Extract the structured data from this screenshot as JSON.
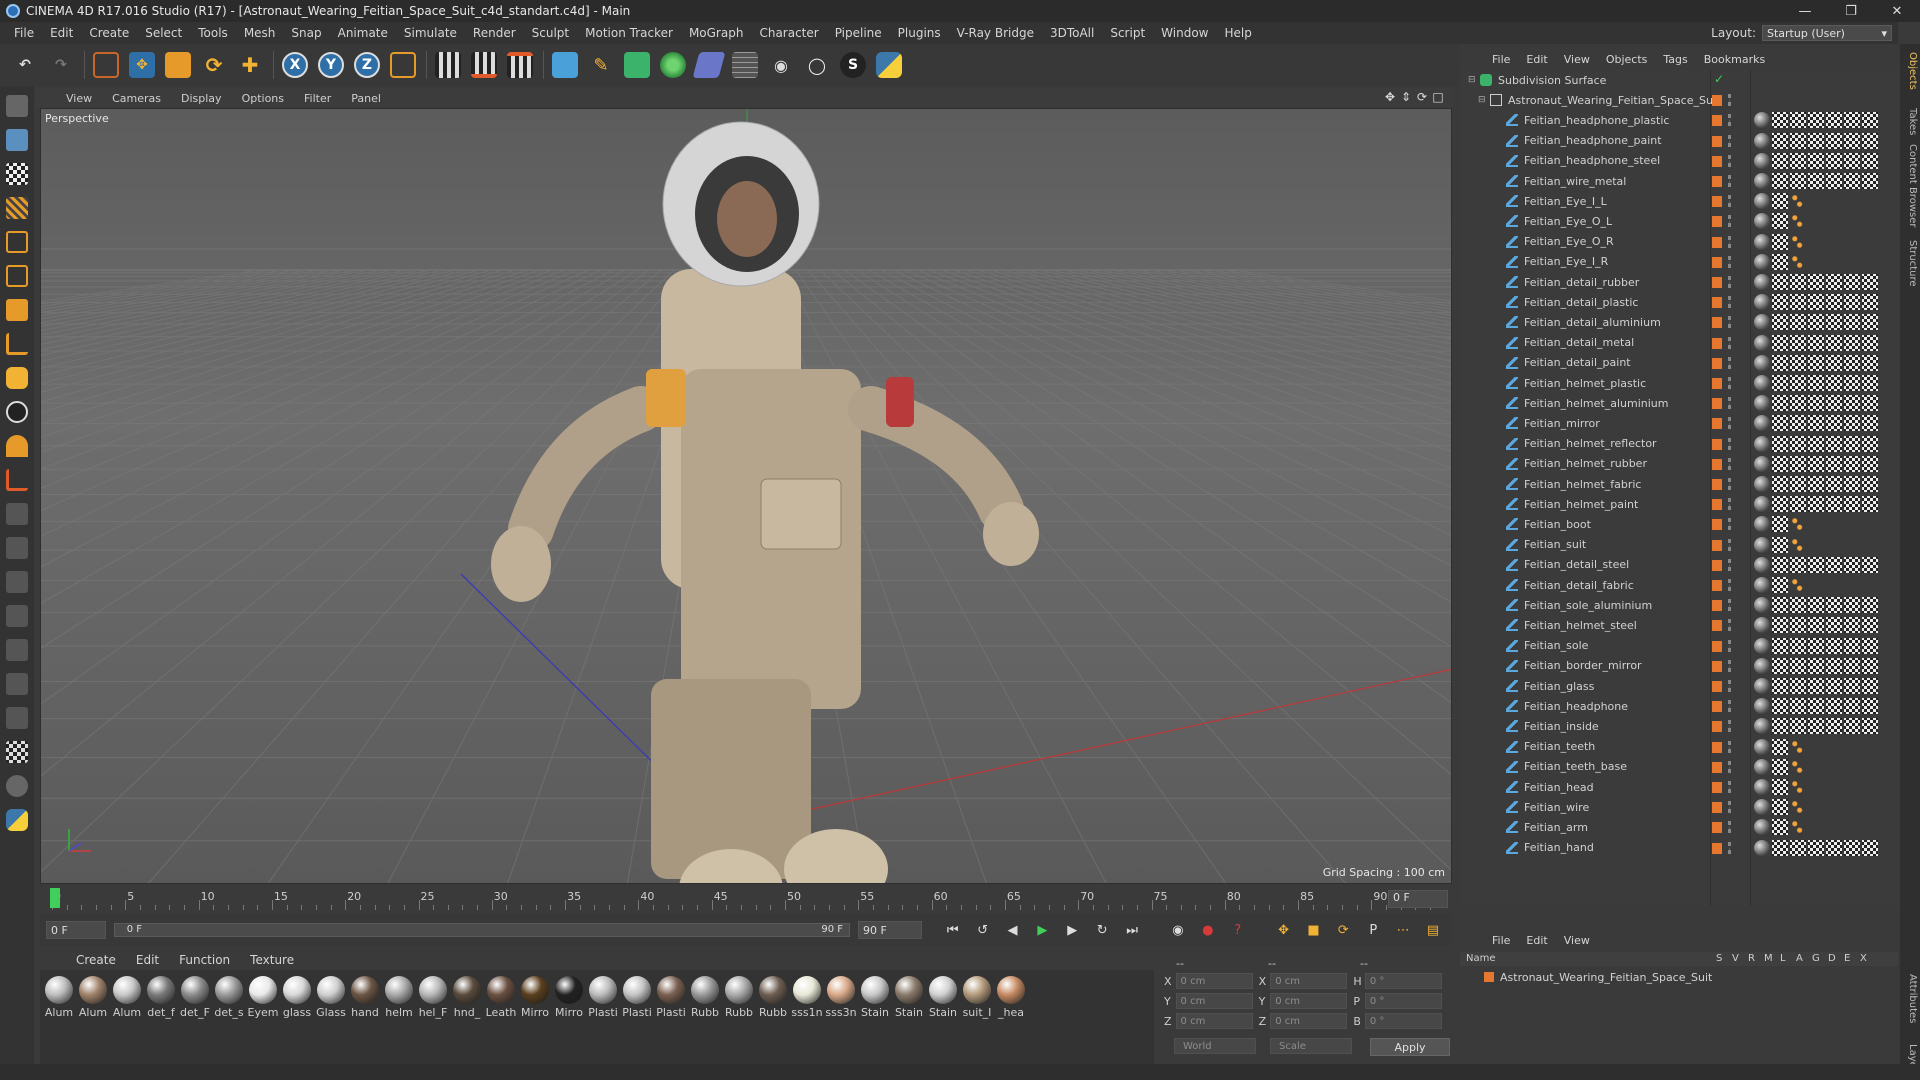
{
  "window": {
    "title": "CINEMA 4D R17.016 Studio (R17) - [Astronaut_Wearing_Feitian_Space_Suit_c4d_standart.c4d] - Main"
  },
  "menu": [
    "File",
    "Edit",
    "Create",
    "Select",
    "Tools",
    "Mesh",
    "Snap",
    "Animate",
    "Simulate",
    "Render",
    "Sculpt",
    "Motion Tracker",
    "MoGraph",
    "Character",
    "Pipeline",
    "Plugins",
    "V-Ray Bridge",
    "3DToAll",
    "Script",
    "Window",
    "Help"
  ],
  "layout": {
    "label": "Layout:",
    "value": "Startup (User)"
  },
  "viewport": {
    "menu": [
      "View",
      "Cameras",
      "Display",
      "Options",
      "Filter",
      "Panel"
    ],
    "camera": "Perspective",
    "grid_spacing": "Grid Spacing : 100 cm"
  },
  "timeline": {
    "ticks": [
      "0",
      "5",
      "10",
      "15",
      "20",
      "25",
      "30",
      "35",
      "40",
      "45",
      "50",
      "55",
      "60",
      "65",
      "70",
      "75",
      "80",
      "85",
      "90"
    ],
    "current_frame": "0 F"
  },
  "transport": {
    "start": "0 F",
    "slider_left": "0 F",
    "slider_right": "90 F",
    "end": "90 F"
  },
  "materials_menu": [
    "Create",
    "Edit",
    "Function",
    "Texture"
  ],
  "materials": [
    {
      "name": "Alum",
      "color": "#bdbdbd"
    },
    {
      "name": "Alum",
      "color": "#a0826a"
    },
    {
      "name": "Alum",
      "color": "#c8c8c8"
    },
    {
      "name": "det_f",
      "color": "#7a7a7a"
    },
    {
      "name": "det_F",
      "color": "#8c8c8c"
    },
    {
      "name": "det_s",
      "color": "#9a9a9a"
    },
    {
      "name": "Eyem",
      "color": "#e8e8e8"
    },
    {
      "name": "glass",
      "color": "#d8d8d8"
    },
    {
      "name": "Glass",
      "color": "#cfcfcf"
    },
    {
      "name": "hand",
      "color": "#6b5544"
    },
    {
      "name": "helm",
      "color": "#a9a9a9"
    },
    {
      "name": "hel_F",
      "color": "#b7b7b7"
    },
    {
      "name": "hnd_",
      "color": "#5a4a3c"
    },
    {
      "name": "Leath",
      "color": "#6a5040"
    },
    {
      "name": "Mirro",
      "color": "#5a3e1c"
    },
    {
      "name": "Mirro",
      "color": "#222222"
    },
    {
      "name": "Plasti",
      "color": "#bbbbbb"
    },
    {
      "name": "Plasti",
      "color": "#c4c4c4"
    },
    {
      "name": "Plasti",
      "color": "#7a6050"
    },
    {
      "name": "Rubb",
      "color": "#9a9a9a"
    },
    {
      "name": "Rubb",
      "color": "#aaaaaa"
    },
    {
      "name": "Rubb",
      "color": "#6e5e52"
    },
    {
      "name": "sss1n",
      "color": "#e8e8d8"
    },
    {
      "name": "sss3n",
      "color": "#d8a888"
    },
    {
      "name": "Stain",
      "color": "#c8c8c8"
    },
    {
      "name": "Stain",
      "color": "#8a7a6a"
    },
    {
      "name": "Stain",
      "color": "#d0d0d0"
    },
    {
      "name": "suit_I",
      "color": "#b49a7c"
    },
    {
      "name": "_hea",
      "color": "#c68a62"
    }
  ],
  "coords": {
    "header": [
      "--",
      "--",
      "--"
    ],
    "rows": [
      {
        "a": "X",
        "v1": "0 cm",
        "b": "X",
        "v2": "0 cm",
        "c": "H",
        "v3": "0 °"
      },
      {
        "a": "Y",
        "v1": "0 cm",
        "b": "Y",
        "v2": "0 cm",
        "c": "P",
        "v3": "0 °"
      },
      {
        "a": "Z",
        "v1": "0 cm",
        "b": "Z",
        "v2": "0 cm",
        "c": "B",
        "v3": "0 °"
      }
    ],
    "mode1": "World",
    "mode2": "Scale",
    "apply": "Apply"
  },
  "objects_menu": [
    "File",
    "Edit",
    "View",
    "Objects",
    "Tags",
    "Bookmarks"
  ],
  "objects": [
    {
      "name": "Subdivision Surface",
      "level": 0,
      "tags": "check"
    },
    {
      "name": "Astronaut_Wearing_Feitian_Space_Suit",
      "level": 1,
      "tags": "none"
    },
    {
      "name": "Feitian_headphone_plastic",
      "level": 2,
      "tags": "full"
    },
    {
      "name": "Feitian_headphone_paint",
      "level": 2,
      "tags": "full"
    },
    {
      "name": "Feitian_headphone_steel",
      "level": 2,
      "tags": "full"
    },
    {
      "name": "Feitian_wire_metal",
      "level": 2,
      "tags": "full"
    },
    {
      "name": "Feitian_Eye_I_L",
      "level": 2,
      "tags": "short"
    },
    {
      "name": "Feitian_Eye_O_L",
      "level": 2,
      "tags": "short"
    },
    {
      "name": "Feitian_Eye_O_R",
      "level": 2,
      "tags": "short"
    },
    {
      "name": "Feitian_Eye_I_R",
      "level": 2,
      "tags": "short"
    },
    {
      "name": "Feitian_detail_rubber",
      "level": 2,
      "tags": "full"
    },
    {
      "name": "Feitian_detail_plastic",
      "level": 2,
      "tags": "full"
    },
    {
      "name": "Feitian_detail_aluminium",
      "level": 2,
      "tags": "full"
    },
    {
      "name": "Feitian_detail_metal",
      "level": 2,
      "tags": "full"
    },
    {
      "name": "Feitian_detail_paint",
      "level": 2,
      "tags": "full"
    },
    {
      "name": "Feitian_helmet_plastic",
      "level": 2,
      "tags": "full"
    },
    {
      "name": "Feitian_helmet_aluminium",
      "level": 2,
      "tags": "full"
    },
    {
      "name": "Feitian_mirror",
      "level": 2,
      "tags": "full"
    },
    {
      "name": "Feitian_helmet_reflector",
      "level": 2,
      "tags": "full"
    },
    {
      "name": "Feitian_helmet_rubber",
      "level": 2,
      "tags": "full"
    },
    {
      "name": "Feitian_helmet_fabric",
      "level": 2,
      "tags": "full"
    },
    {
      "name": "Feitian_helmet_paint",
      "level": 2,
      "tags": "full"
    },
    {
      "name": "Feitian_boot",
      "level": 2,
      "tags": "short"
    },
    {
      "name": "Feitian_suit",
      "level": 2,
      "tags": "short"
    },
    {
      "name": "Feitian_detail_steel",
      "level": 2,
      "tags": "full"
    },
    {
      "name": "Feitian_detail_fabric",
      "level": 2,
      "tags": "short"
    },
    {
      "name": "Feitian_sole_aluminium",
      "level": 2,
      "tags": "full"
    },
    {
      "name": "Feitian_helmet_steel",
      "level": 2,
      "tags": "full"
    },
    {
      "name": "Feitian_sole",
      "level": 2,
      "tags": "full"
    },
    {
      "name": "Feitian_border_mirror",
      "level": 2,
      "tags": "full"
    },
    {
      "name": "Feitian_glass",
      "level": 2,
      "tags": "full"
    },
    {
      "name": "Feitian_headphone",
      "level": 2,
      "tags": "full"
    },
    {
      "name": "Feitian_inside",
      "level": 2,
      "tags": "full"
    },
    {
      "name": "Feitian_teeth",
      "level": 2,
      "tags": "short"
    },
    {
      "name": "Feitian_teeth_base",
      "level": 2,
      "tags": "short"
    },
    {
      "name": "Feitian_head",
      "level": 2,
      "tags": "short"
    },
    {
      "name": "Feitian_wire",
      "level": 2,
      "tags": "short"
    },
    {
      "name": "Feitian_arm",
      "level": 2,
      "tags": "short"
    },
    {
      "name": "Feitian_hand",
      "level": 2,
      "tags": "full"
    }
  ],
  "attributes_menu": [
    "File",
    "Edit",
    "View"
  ],
  "attributes": {
    "name_col": "Name",
    "cols": [
      "S",
      "V",
      "R",
      "M",
      "L",
      "A",
      "G",
      "D",
      "E",
      "X"
    ],
    "row": "Astronaut_Wearing_Feitian_Space_Suit"
  },
  "sidetabs": [
    "Objects",
    "Takes",
    "Content Browser",
    "Structure",
    "Attributes",
    "Layers"
  ],
  "colors": {
    "accent": "#e6772e",
    "playhead": "#3fcf5a",
    "bg": "#3a3a3a"
  }
}
